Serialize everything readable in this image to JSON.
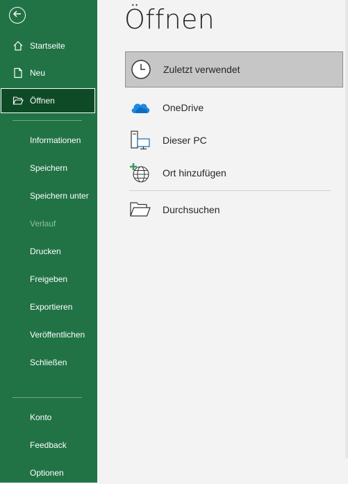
{
  "sidebar": {
    "back_icon": "back-arrow-icon",
    "items": [
      {
        "label": "Startseite",
        "icon": "home-icon"
      },
      {
        "label": "Neu",
        "icon": "new-document-icon"
      },
      {
        "label": "Öffnen",
        "icon": "open-folder-icon",
        "active": true
      },
      {
        "label": "Informationen"
      },
      {
        "label": "Speichern"
      },
      {
        "label": "Speichern unter"
      },
      {
        "label": "Verlauf",
        "disabled": true
      },
      {
        "label": "Drucken"
      },
      {
        "label": "Freigeben"
      },
      {
        "label": "Exportieren"
      },
      {
        "label": "Veröffentlichen"
      },
      {
        "label": "Schließen"
      },
      {
        "label": "Konto"
      },
      {
        "label": "Feedback"
      },
      {
        "label": "Optionen"
      }
    ]
  },
  "main": {
    "title": "Öffnen",
    "locations": [
      {
        "label": "Zuletzt verwendet",
        "icon": "clock-icon",
        "selected": true
      },
      {
        "label": "OneDrive",
        "icon": "onedrive-cloud-icon"
      },
      {
        "label": "Dieser PC",
        "icon": "computer-icon"
      },
      {
        "label": "Ort hinzufügen",
        "icon": "add-place-globe-icon"
      },
      {
        "label": "Durchsuchen",
        "icon": "browse-folder-icon"
      }
    ]
  },
  "colors": {
    "sidebar_bg": "#217346",
    "sidebar_active_bg": "#0e4a26",
    "main_bg": "#f3f3f3",
    "selected_bg": "#c6c6c6",
    "onedrive_blue": "#0f6cbd"
  }
}
